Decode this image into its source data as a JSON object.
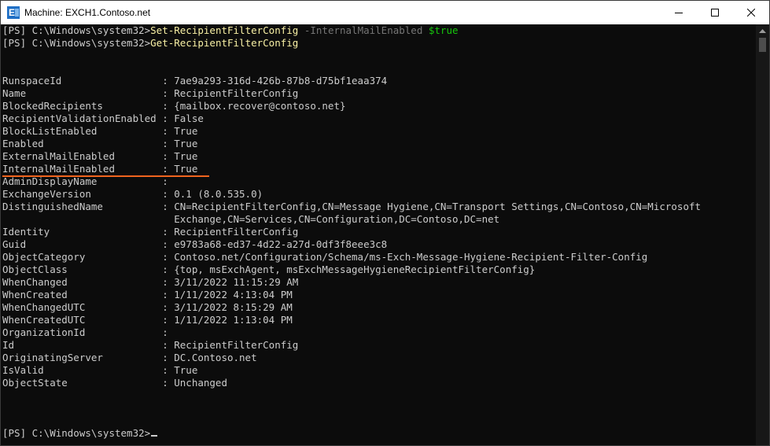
{
  "window": {
    "title": "Machine: EXCH1.Contoso.net",
    "icon": "exchange-app-icon",
    "controls": [
      "minimize-icon",
      "maximize-icon",
      "close-icon"
    ]
  },
  "console": {
    "cmd1": {
      "prompt": "[PS] C:\\Windows\\system32>",
      "cmdlet": "Set-RecipientFilterConfig",
      "param": " -InternalMailEnabled",
      "value": " $true"
    },
    "cmd2": {
      "prompt": "[PS] C:\\Windows\\system32>",
      "cmdlet": "Get-RecipientFilterConfig"
    },
    "output": [
      {
        "label": "RunspaceId                 ",
        "value": ": 7ae9a293-316d-426b-87b8-d75bf1eaa374"
      },
      {
        "label": "Name                       ",
        "value": ": RecipientFilterConfig"
      },
      {
        "label": "BlockedRecipients          ",
        "value": ": {mailbox.recover@contoso.net}"
      },
      {
        "label": "RecipientValidationEnabled ",
        "value": ": False"
      },
      {
        "label": "BlockListEnabled           ",
        "value": ": True"
      },
      {
        "label": "Enabled                    ",
        "value": ": True"
      },
      {
        "label": "ExternalMailEnabled        ",
        "value": ": True"
      },
      {
        "label": "InternalMailEnabled        ",
        "value": ": True"
      },
      {
        "label": "AdminDisplayName           ",
        "value": ":"
      },
      {
        "label": "ExchangeVersion            ",
        "value": ": 0.1 (8.0.535.0)"
      },
      {
        "label": "DistinguishedName          ",
        "value": ": CN=RecipientFilterConfig,CN=Message Hygiene,CN=Transport Settings,CN=Contoso,CN=Microsoft"
      },
      {
        "label": "                           ",
        "value": "  Exchange,CN=Services,CN=Configuration,DC=Contoso,DC=net"
      },
      {
        "label": "Identity                   ",
        "value": ": RecipientFilterConfig"
      },
      {
        "label": "Guid                       ",
        "value": ": e9783a68-ed37-4d22-a27d-0df3f8eee3c8"
      },
      {
        "label": "ObjectCategory             ",
        "value": ": Contoso.net/Configuration/Schema/ms-Exch-Message-Hygiene-Recipient-Filter-Config"
      },
      {
        "label": "ObjectClass                ",
        "value": ": {top, msExchAgent, msExchMessageHygieneRecipientFilterConfig}"
      },
      {
        "label": "WhenChanged                ",
        "value": ": 3/11/2022 11:15:29 AM"
      },
      {
        "label": "WhenCreated                ",
        "value": ": 1/11/2022 4:13:04 PM"
      },
      {
        "label": "WhenChangedUTC             ",
        "value": ": 3/11/2022 8:15:29 AM"
      },
      {
        "label": "WhenCreatedUTC             ",
        "value": ": 1/11/2022 1:13:04 PM"
      },
      {
        "label": "OrganizationId             ",
        "value": ":"
      },
      {
        "label": "Id                         ",
        "value": ": RecipientFilterConfig"
      },
      {
        "label": "OriginatingServer          ",
        "value": ": DC.Contoso.net"
      },
      {
        "label": "IsValid                    ",
        "value": ": True"
      },
      {
        "label": "ObjectState                ",
        "value": ": Unchanged"
      }
    ],
    "final_prompt": "[PS] C:\\Windows\\system32>"
  },
  "colors": {
    "background": "#0c0c0c",
    "text": "#cccccc",
    "cmdlet": "#f9f1a5",
    "parameter": "#767676",
    "variable": "#16c60c",
    "highlight_underline": "#f0641e"
  }
}
